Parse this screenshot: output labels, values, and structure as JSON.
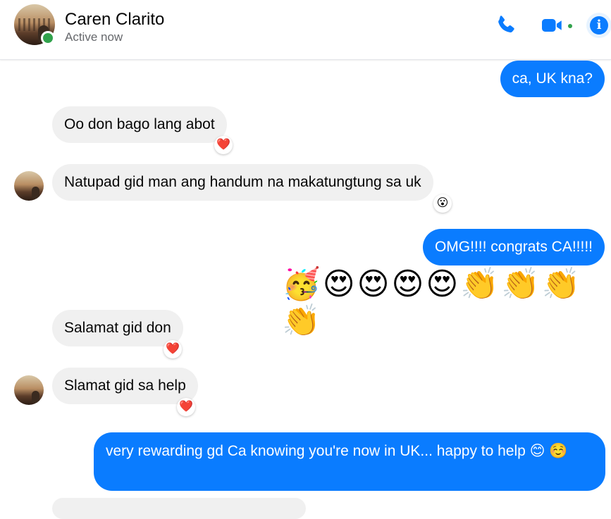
{
  "contact": {
    "name": "Caren Clarito",
    "status": "Active now"
  },
  "colors": {
    "accent": "#0a7cff",
    "online": "#31a24c",
    "incoming_bg": "#f0f0f0",
    "heart": "#f3425f"
  },
  "header_icons": [
    "phone-icon",
    "video-call-icon",
    "info-icon"
  ],
  "messages": [
    {
      "id": "m1",
      "direction": "out",
      "text": "ca, UK kna?"
    },
    {
      "id": "m2",
      "direction": "in",
      "text": "Oo don bago lang abot",
      "reaction": "❤️"
    },
    {
      "id": "m3",
      "direction": "in",
      "text": "Natupad gid man ang handum na makatungtung sa uk",
      "reaction": "😮"
    },
    {
      "id": "m4",
      "direction": "out",
      "text": "OMG!!!! congrats CA!!!!!"
    },
    {
      "id": "m5",
      "direction": "out",
      "text": "🥳😍😍😍😍👏👏👏👏"
    },
    {
      "id": "m6",
      "direction": "in",
      "text": "Salamat gid don",
      "reaction": "❤️"
    },
    {
      "id": "m7",
      "direction": "in",
      "text": "Slamat gid sa help",
      "reaction": "❤️"
    },
    {
      "id": "m8",
      "direction": "out",
      "text": "very rewarding gd Ca knowing you're now in UK... happy to help 😊 ☺️"
    }
  ]
}
